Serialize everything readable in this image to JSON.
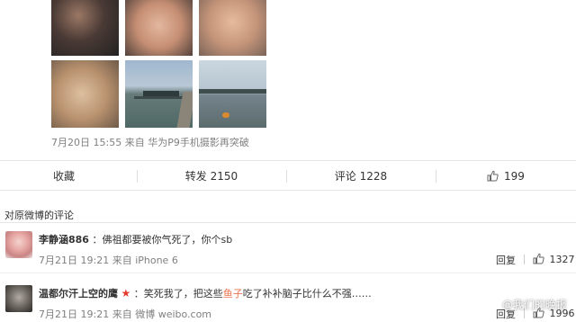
{
  "post": {
    "time": "7月20日 15:55",
    "source": "来自 华为P9手机摄影再突破"
  },
  "actions": {
    "favorite": "收藏",
    "repost_label": "转发",
    "repost_count": "2150",
    "comment_label": "评论",
    "comment_count": "1228",
    "like_count": "199"
  },
  "comments_section": {
    "title": "对原微博的评论"
  },
  "comments": [
    {
      "user": "李静涵886",
      "text": "：佛祖都要被你气死了，你个sb",
      "time": "7月21日 19:21",
      "source": "来自 iPhone 6",
      "reply_label": "回复",
      "likes": "1327"
    },
    {
      "user": "温都尔汗上空的鹰",
      "text_before": "：笑死我了，把这些",
      "text_highlight": "鱼子",
      "text_after": "吃了补补脑子比什么不强……",
      "time": "7月21日 19:21",
      "source": "来自 微博 weibo.com",
      "reply_label": "回复",
      "likes": "1996"
    }
  ],
  "watermark": {
    "text": "@我们的晚报"
  },
  "colors": {
    "highlight": "#eb7350",
    "star_badge": "#e23b2e",
    "meta_text": "#808080"
  }
}
